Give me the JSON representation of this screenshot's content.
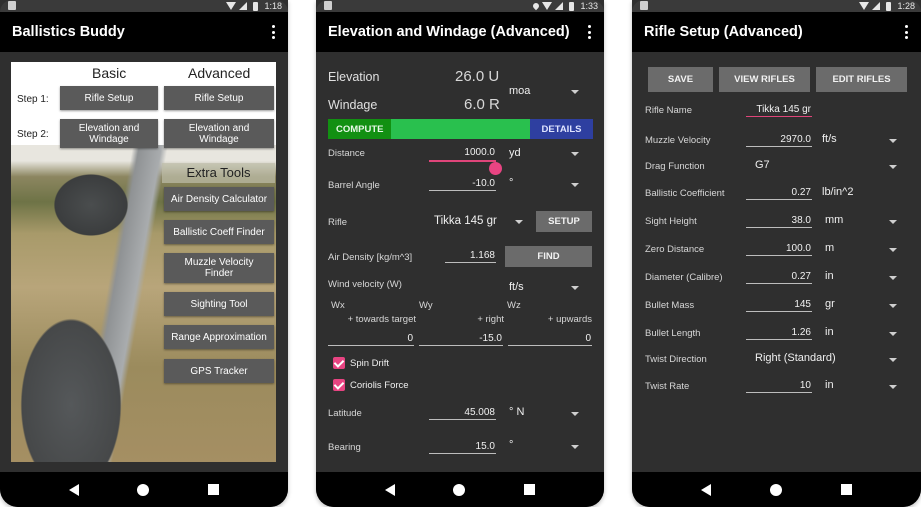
{
  "phones": [
    {
      "status_time": "1:18",
      "title": "Ballistics Buddy",
      "columns": [
        "Basic",
        "Advanced"
      ],
      "steps": [
        {
          "label": "Step 1:",
          "basic": "Rifle Setup",
          "advanced": "Rifle Setup"
        },
        {
          "label": "Step 2:",
          "basic": "Elevation and Windage",
          "advanced": "Elevation and Windage"
        }
      ],
      "extra_tools_title": "Extra Tools",
      "extra_tools": [
        "Air Density Calculator",
        "Ballistic Coeff Finder",
        "Muzzle Velocity Finder",
        "Sighting Tool",
        "Range Approximation",
        "GPS Tracker"
      ]
    },
    {
      "status_time": "1:33",
      "title": "Elevation and Windage (Advanced)",
      "elevation": {
        "label": "Elevation",
        "value": "26.0 U"
      },
      "windage": {
        "label": "Windage",
        "value": "6.0 R"
      },
      "angle_unit": "moa",
      "compute_label": "COMPUTE",
      "details_label": "DETAILS",
      "compute_progress": 1.0,
      "distance": {
        "label": "Distance",
        "value": "1000.0",
        "unit": "yd",
        "slider_fraction": 1.0
      },
      "barrel_angle": {
        "label": "Barrel Angle",
        "value": "-10.0",
        "unit": "°"
      },
      "rifle": {
        "label": "Rifle",
        "value": "Tikka 145 gr",
        "button": "SETUP"
      },
      "air_density": {
        "label": "Air Density [kg/m^3]",
        "value": "1.168",
        "button": "FIND"
      },
      "wind": {
        "label": "Wind velocity (W)",
        "unit": "ft/s",
        "components": [
          {
            "name": "Wx",
            "hint": "+ towards target",
            "value": "0"
          },
          {
            "name": "Wy",
            "hint": "+ right",
            "value": "-15.0"
          },
          {
            "name": "Wz",
            "hint": "+ upwards",
            "value": "0"
          }
        ]
      },
      "spin_drift": {
        "label": "Spin Drift",
        "checked": true
      },
      "coriolis": {
        "label": "Coriolis Force",
        "checked": true
      },
      "latitude": {
        "label": "Latitude",
        "value": "45.008",
        "unit": "° N"
      },
      "bearing": {
        "label": "Bearing",
        "value": "15.0",
        "unit": "°"
      }
    },
    {
      "status_time": "1:28",
      "title": "Rifle Setup (Advanced)",
      "buttons": {
        "save": "SAVE",
        "view": "VIEW RIFLES",
        "edit": "EDIT RIFLES"
      },
      "rifle_name": {
        "label": "Rifle Name",
        "value": "Tikka 145 gr"
      },
      "rows": [
        {
          "label": "Muzzle Velocity",
          "value": "2970.0",
          "unit": "ft/s",
          "dropdown": true
        },
        {
          "label": "Drag Function",
          "value": "G7",
          "unit": "",
          "dropdown": true
        },
        {
          "label": "Ballistic Coefficient",
          "value": "0.27",
          "unit": "lb/in^2",
          "dropdown": false
        },
        {
          "label": "Sight Height",
          "value": "38.0",
          "unit": "mm",
          "dropdown": true
        },
        {
          "label": "Zero Distance",
          "value": "100.0",
          "unit": "m",
          "dropdown": true
        },
        {
          "label": "Diameter (Calibre)",
          "value": "0.27",
          "unit": "in",
          "dropdown": true
        },
        {
          "label": "Bullet Mass",
          "value": "145",
          "unit": "gr",
          "dropdown": true
        },
        {
          "label": "Bullet Length",
          "value": "1.26",
          "unit": "in",
          "dropdown": true
        },
        {
          "label": "Twist Direction",
          "value": "Right (Standard)",
          "unit": "",
          "dropdown": true
        },
        {
          "label": "Twist Rate",
          "value": "10",
          "unit": "in",
          "dropdown": true
        }
      ]
    }
  ]
}
